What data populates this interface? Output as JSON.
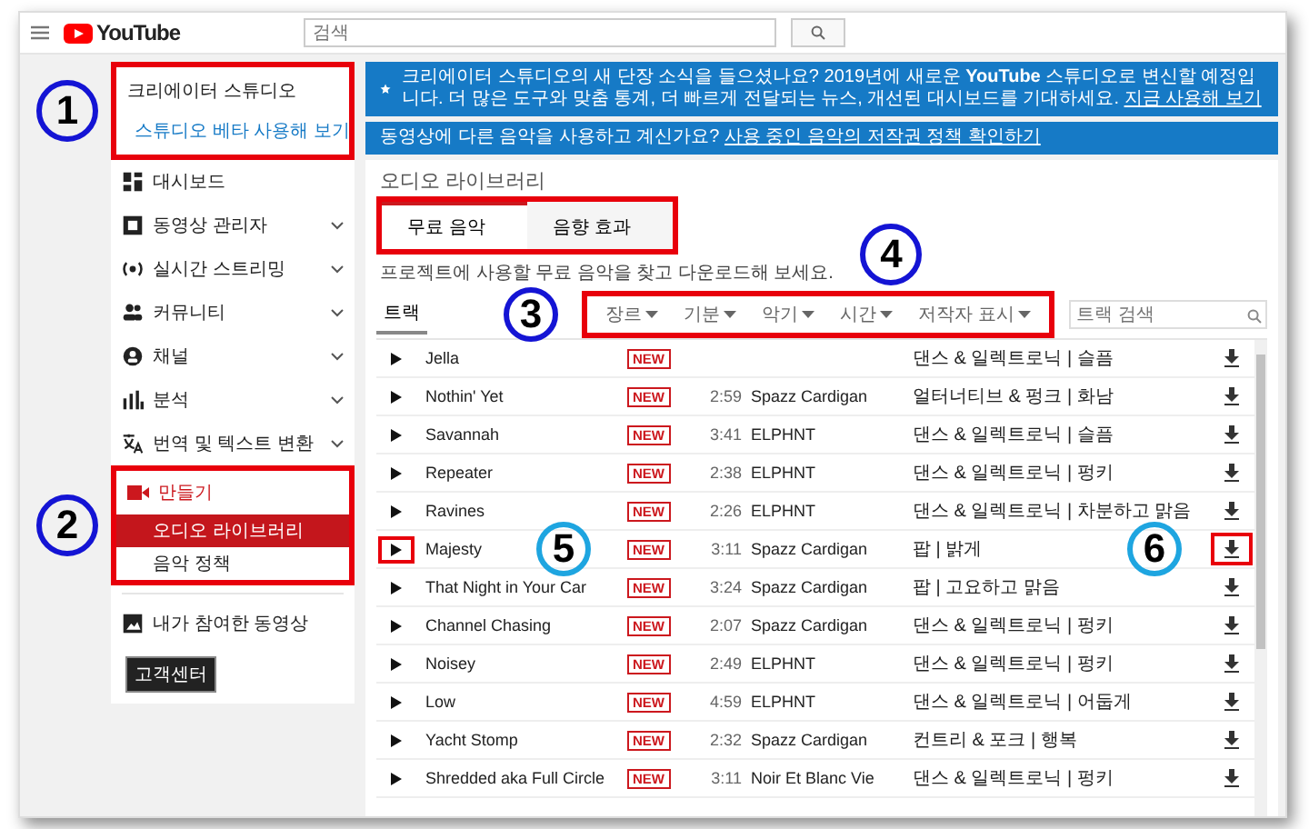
{
  "header": {
    "logo": "YouTube",
    "search": {
      "placeholder": "검색"
    }
  },
  "sidebar": {
    "studio": {
      "title": "크리에이터 스튜디오",
      "beta_link": "스튜디오 베타 사용해 보기",
      "annotation": {
        "label": "1",
        "color": "#1414d4"
      }
    },
    "items": [
      {
        "label": "대시보드",
        "expandable": false
      },
      {
        "label": "동영상 관리자",
        "expandable": true
      },
      {
        "label": "실시간 스트리밍",
        "expandable": true
      },
      {
        "label": "커뮤니티",
        "expandable": true
      },
      {
        "label": "채널",
        "expandable": true
      },
      {
        "label": "분석",
        "expandable": true
      },
      {
        "label": "번역 및 텍스트 변환",
        "expandable": true
      }
    ],
    "create": {
      "label": "만들기",
      "expanded": true,
      "annotation": {
        "label": "2",
        "color": "#1414d4"
      },
      "children": [
        {
          "label": "오디오 라이브러리",
          "selected": true
        },
        {
          "label": "음악 정책",
          "selected": false
        }
      ]
    },
    "extra_item": "내가 참여한 동영상",
    "help_button": "고객센터"
  },
  "banners": [
    {
      "kind": "star",
      "text": "크리에이터 스튜디오의 새 단장 소식을 들으셨나요? 2019년에 새로운 **YouTube** 스튜디오로 변신할 예정입니다. 더 많은 도구와 맞춤 통계, 더 빠르게 전달되는 뉴스, 개선된 대시보드를 기대하세요.",
      "link": "지금 사용해 보기"
    },
    {
      "kind": "plain",
      "text": "동영상에 다른 음악을 사용하고 계신가요?",
      "link": "사용 중인 음악의 저작권 정책 확인하기"
    }
  ],
  "page_title": "오디오 라이브러리",
  "tabs": [
    {
      "label": "무료 음악",
      "selected": true
    },
    {
      "label": "음향 효과",
      "selected": false
    }
  ],
  "tabs_annotation": {
    "label": "3",
    "color": "#1414d4"
  },
  "description": "프로젝트에 사용할 무료 음악을 찾고 다운로드해 보세요.",
  "subtabs": [
    {
      "label": "트랙",
      "selected": true
    }
  ],
  "filters": [
    "장르",
    "기분",
    "악기",
    "시간",
    "저작자 표시"
  ],
  "filters_annotation": {
    "label": "4",
    "color": "#1414d4"
  },
  "track_search": {
    "placeholder": "트랙 검색"
  },
  "tracks": [
    {
      "title": "Jella",
      "badge": "NEW",
      "genre": "댄스 & 일렉트로닉 | 슬픔"
    },
    {
      "title": "Nothin' Yet",
      "badge": "NEW",
      "duration": "2:59",
      "artist": "Spazz Cardigan",
      "genre": "얼터너티브 & 펑크 | 화남"
    },
    {
      "title": "Savannah",
      "badge": "NEW",
      "duration": "3:41",
      "artist": "ELPHNT",
      "genre": "댄스 & 일렉트로닉 | 슬픔"
    },
    {
      "title": "Repeater",
      "badge": "NEW",
      "duration": "2:38",
      "artist": "ELPHNT",
      "genre": "댄스 & 일렉트로닉 | 펑키"
    },
    {
      "title": "Ravines",
      "badge": "NEW",
      "duration": "2:26",
      "artist": "ELPHNT",
      "genre": "댄스 & 일렉트로닉 | 차분하고 맑음"
    },
    {
      "title": "Majesty",
      "badge": "NEW",
      "duration": "3:11",
      "artist": "Spazz Cardigan",
      "genre": "팝 | 밝게",
      "play_annotation": {
        "label": "5",
        "color": "#1ea5e0"
      },
      "download_annotation": {
        "label": "6",
        "color": "#1ea5e0"
      }
    },
    {
      "title": "That Night in Your Car",
      "badge": "NEW",
      "duration": "3:24",
      "artist": "Spazz Cardigan",
      "genre": "팝 | 고요하고 맑음"
    },
    {
      "title": "Channel Chasing",
      "badge": "NEW",
      "duration": "2:07",
      "artist": "Spazz Cardigan",
      "genre": "댄스 & 일렉트로닉 | 펑키"
    },
    {
      "title": "Noisey",
      "badge": "NEW",
      "duration": "2:49",
      "artist": "ELPHNT",
      "genre": "댄스 & 일렉트로닉 | 펑키"
    },
    {
      "title": "Low",
      "badge": "NEW",
      "duration": "4:59",
      "artist": "ELPHNT",
      "genre": "댄스 & 일렉트로닉 | 어둡게"
    },
    {
      "title": "Yacht Stomp",
      "badge": "NEW",
      "duration": "2:32",
      "artist": "Spazz Cardigan",
      "genre": "컨트리 & 포크 | 행복"
    },
    {
      "title": "Shredded aka Full Circle",
      "badge": "NEW",
      "duration": "3:11",
      "artist": "Noir Et Blanc Vie",
      "genre": "댄스 & 일렉트로닉 | 펑키"
    }
  ]
}
